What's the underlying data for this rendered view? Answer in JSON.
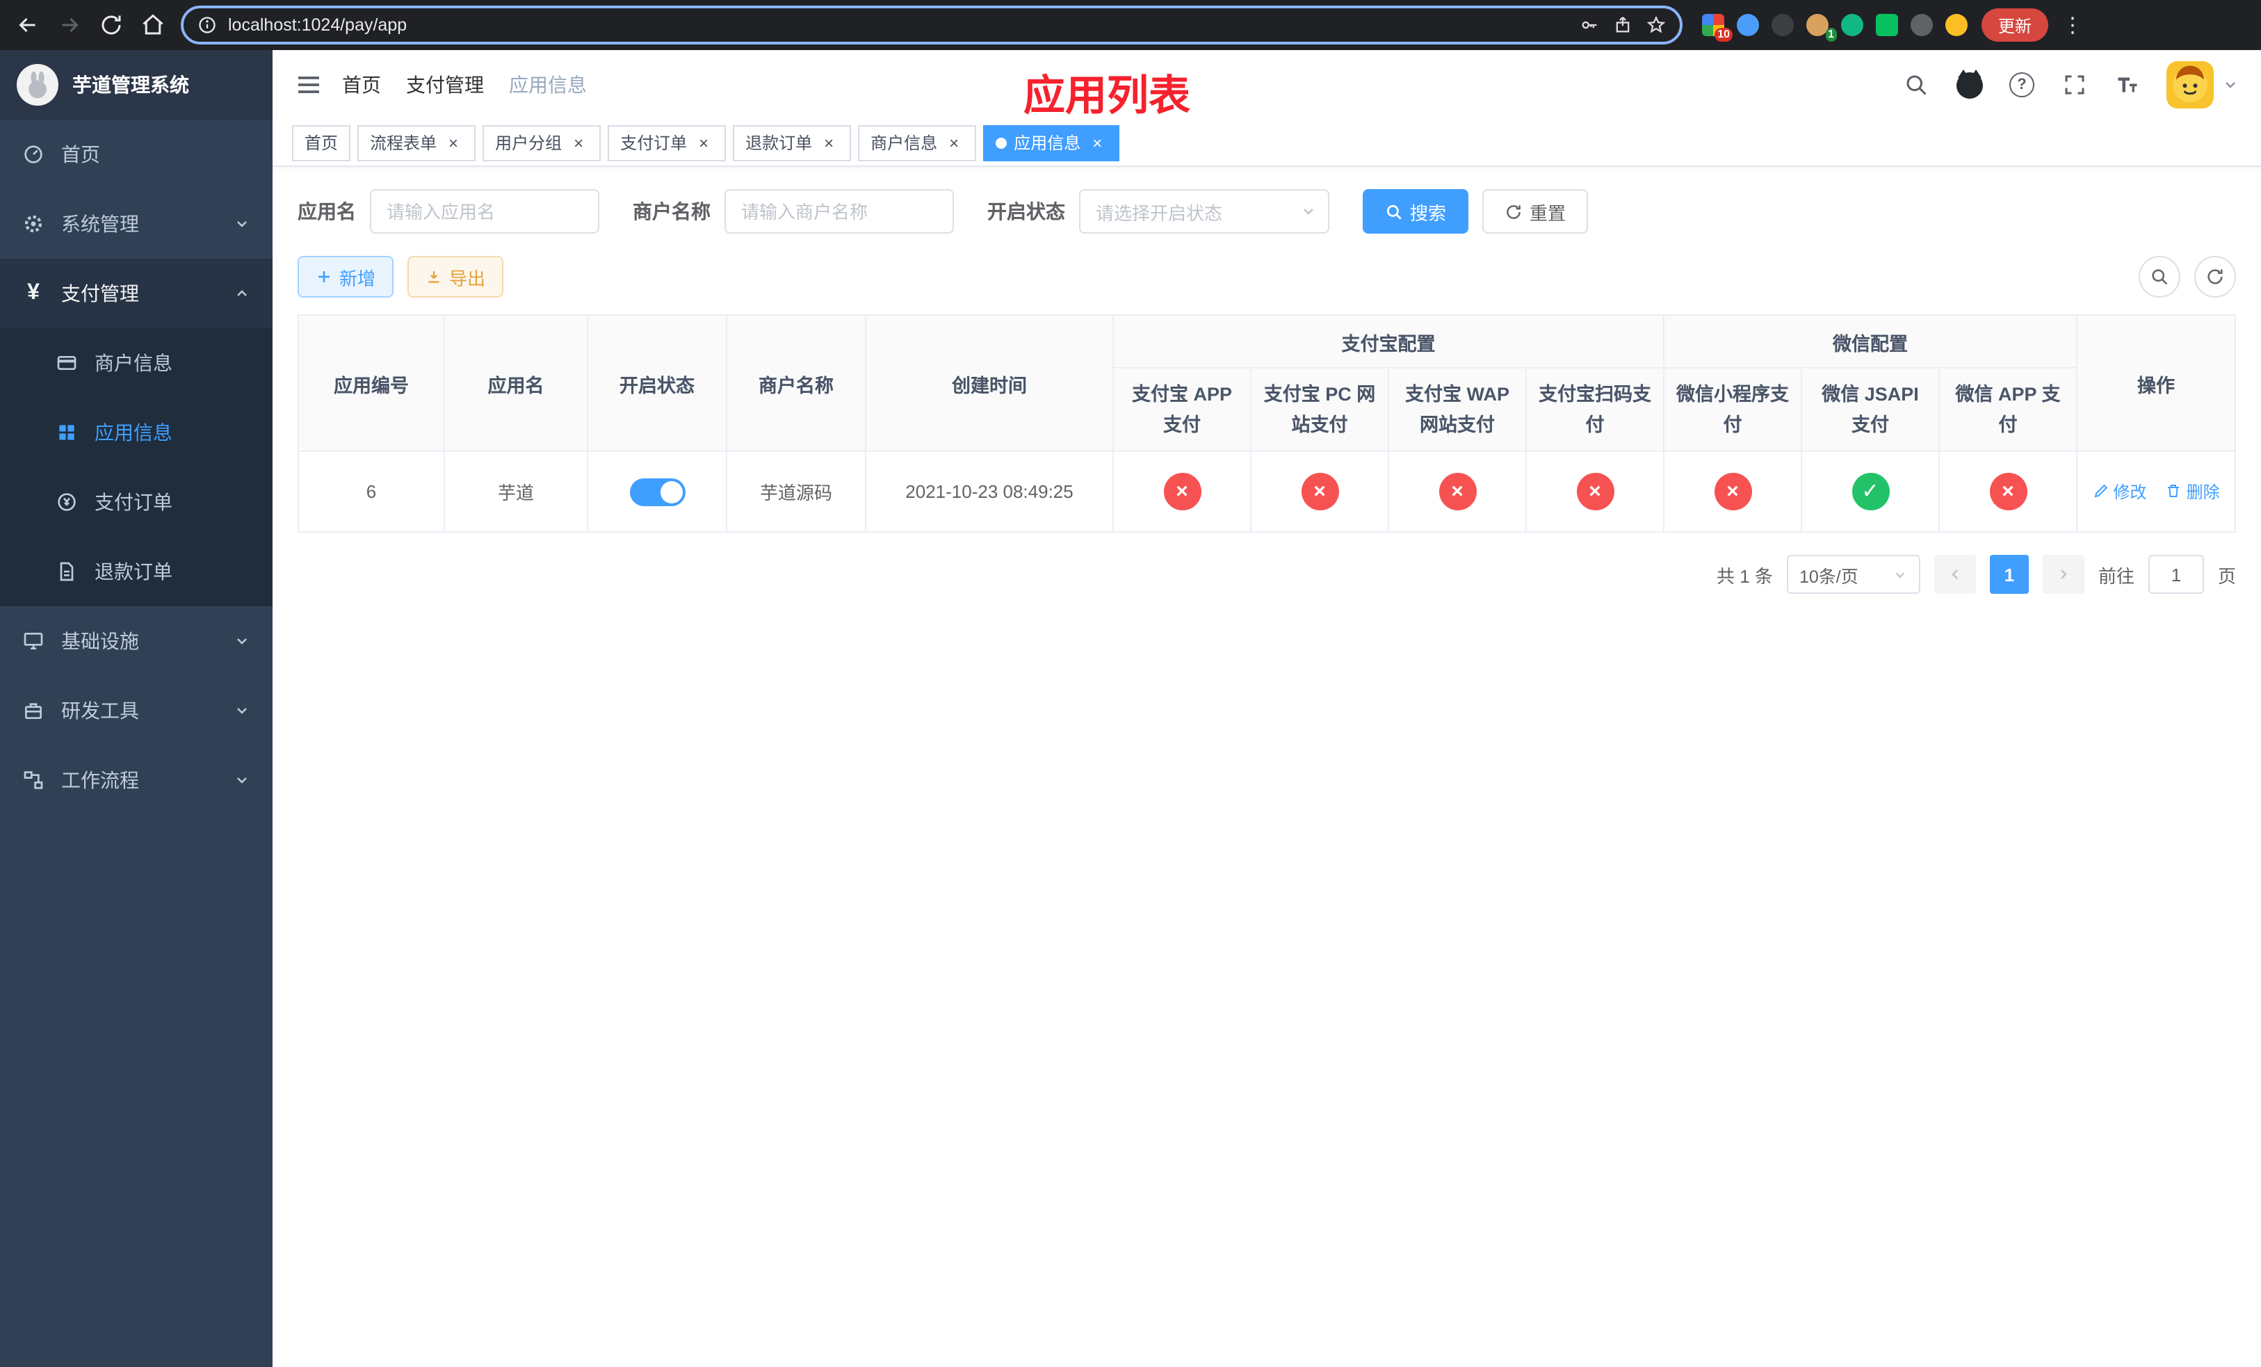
{
  "colors": {
    "primary": "#409EFF",
    "danger": "#f75252",
    "success": "#23c268",
    "sidebar_bg": "#304156",
    "submenu_bg": "#1f2d3d",
    "annotation_red": "#f5222d"
  },
  "browser": {
    "url": "localhost:1024/pay/app",
    "update_button": "更新",
    "ext_badge_1": "10",
    "ext_badge_2": "1"
  },
  "sidebar": {
    "title": "芋道管理系统",
    "items": [
      {
        "label": "首页"
      },
      {
        "label": "系统管理"
      },
      {
        "label": "支付管理"
      },
      {
        "label": "基础设施"
      },
      {
        "label": "研发工具"
      },
      {
        "label": "工作流程"
      }
    ],
    "submenu": [
      {
        "label": "商户信息"
      },
      {
        "label": "应用信息"
      },
      {
        "label": "支付订单"
      },
      {
        "label": "退款订单"
      }
    ]
  },
  "header": {
    "breadcrumb": [
      "首页",
      "支付管理",
      "应用信息"
    ],
    "annotation": "应用列表"
  },
  "tabs": [
    {
      "label": "首页"
    },
    {
      "label": "流程表单"
    },
    {
      "label": "用户分组"
    },
    {
      "label": "支付订单"
    },
    {
      "label": "退款订单"
    },
    {
      "label": "商户信息"
    },
    {
      "label": "应用信息"
    }
  ],
  "filters": {
    "app_name_label": "应用名",
    "app_name_placeholder": "请输入应用名",
    "merchant_label": "商户名称",
    "merchant_placeholder": "请输入商户名称",
    "status_label": "开启状态",
    "status_placeholder": "请选择开启状态",
    "search_button": "搜索",
    "reset_button": "重置"
  },
  "toolbar": {
    "add_button": "新增",
    "export_button": "导出"
  },
  "table": {
    "headers": {
      "app_id": "应用编号",
      "app_name": "应用名",
      "status": "开启状态",
      "merchant": "商户名称",
      "created": "创建时间",
      "alipay_group": "支付宝配置",
      "wechat_group": "微信配置",
      "actions": "操作",
      "alipay_app": "支付宝 APP 支付",
      "alipay_pc": "支付宝 PC 网站支付",
      "alipay_wap": "支付宝 WAP 网站支付",
      "alipay_qr": "支付宝扫码支付",
      "wechat_mini": "微信小程序支付",
      "wechat_jsapi": "微信 JSAPI 支付",
      "wechat_app": "微信 APP 支付"
    },
    "rows": [
      {
        "app_id": "6",
        "app_name": "芋道",
        "enabled": true,
        "merchant": "芋道源码",
        "created": "2021-10-23 08:49:25",
        "configs": [
          false,
          false,
          false,
          false,
          false,
          true,
          false
        ],
        "edit_label": "修改",
        "delete_label": "删除"
      }
    ]
  },
  "pagination": {
    "total": "共 1 条",
    "page_size": "10条/页",
    "page": "1",
    "goto_label": "前往",
    "goto_value": "1",
    "goto_suffix": "页"
  }
}
